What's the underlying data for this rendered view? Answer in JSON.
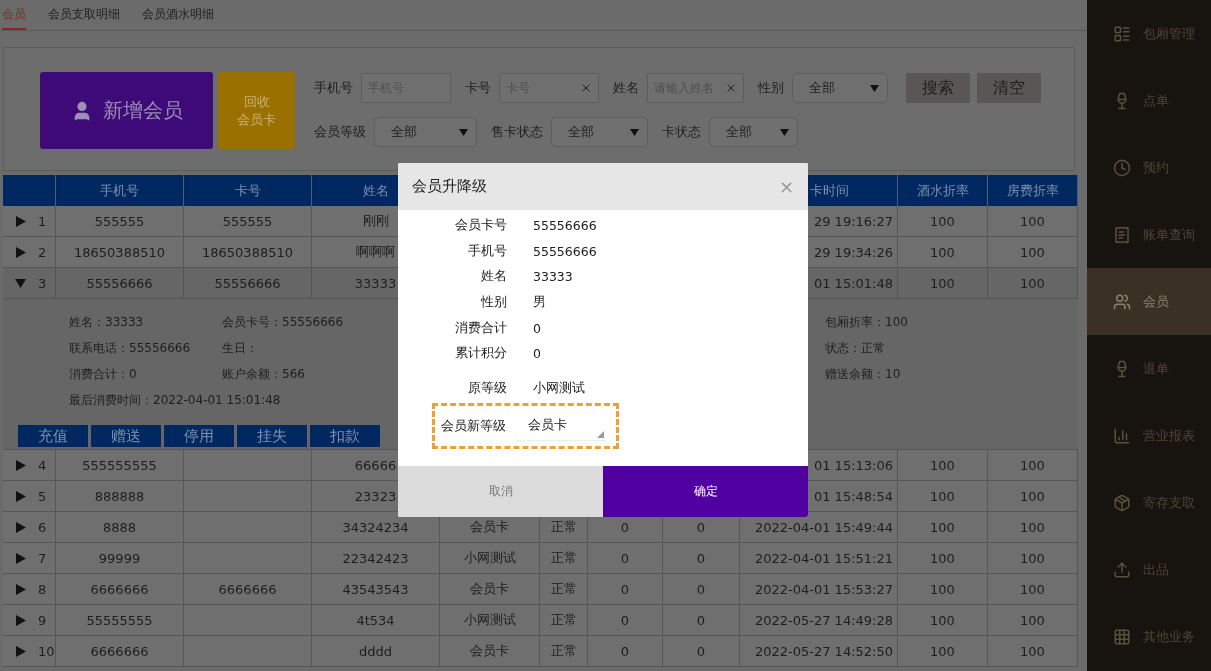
{
  "tabs": [
    {
      "label": "会员",
      "selected": true
    },
    {
      "label": "会员支取明细",
      "selected": false
    },
    {
      "label": "会员酒水明细",
      "selected": false
    }
  ],
  "filters": {
    "new_member": "新增会员",
    "recycle_card": [
      "回收",
      "会员卡"
    ],
    "rows": [
      [
        {
          "kind": "text",
          "label": "手机号",
          "placeholder": "手机号"
        },
        {
          "kind": "clearable",
          "label": "卡号",
          "placeholder": "卡号"
        },
        {
          "kind": "clearable",
          "label": "姓名",
          "placeholder": "请输入姓名"
        },
        {
          "kind": "select",
          "label": "性别",
          "value": "全部"
        }
      ],
      [
        {
          "kind": "select",
          "label": "会员等级",
          "value": "全部"
        },
        {
          "kind": "select",
          "label": "售卡状态",
          "value": "全部"
        },
        {
          "kind": "select",
          "label": "卡状态",
          "value": "全部"
        }
      ]
    ],
    "buttons": [
      "搜索",
      "清空"
    ]
  },
  "table": {
    "columns": [
      "",
      "手机号",
      "卡号",
      "姓名",
      "",
      "",
      "",
      "",
      "卡时间",
      "酒水折率",
      "房费折率"
    ],
    "rows": [
      {
        "expanded": false,
        "cells": [
          "1",
          "555555",
          "555555",
          "刚刚",
          "",
          "",
          "",
          "",
          "29 19:16:27",
          "100",
          "100"
        ]
      },
      {
        "expanded": false,
        "cells": [
          "2",
          "18650388510",
          "18650388510",
          "啊啊啊",
          "",
          "",
          "",
          "",
          "29 19:34:26",
          "100",
          "100"
        ]
      },
      {
        "expanded": true,
        "cells": [
          "3",
          "55556666",
          "55556666",
          "33333",
          "",
          "",
          "",
          "",
          "01 15:01:48",
          "100",
          "100"
        ],
        "details": [
          [
            "姓名：33333",
            "会员卡号：55556666",
            "包厢折率：100"
          ],
          [
            "联系电话：55556666",
            "生日：",
            "状态：正常"
          ],
          [
            "消费合计：0",
            "账户余额：566",
            "赠送余额：10"
          ],
          [
            "最后消费时间：2022-04-01 15:01:48"
          ]
        ],
        "actions": [
          "充值",
          "赠送",
          "停用",
          "挂失",
          "扣款"
        ]
      },
      {
        "expanded": false,
        "cells": [
          "4",
          "555555555",
          "",
          "66666",
          "",
          "",
          "",
          "",
          "01 15:13:06",
          "100",
          "100"
        ]
      },
      {
        "expanded": false,
        "cells": [
          "5",
          "888888",
          "",
          "23323",
          "",
          "",
          "",
          "",
          "01 15:48:54",
          "100",
          "100"
        ]
      },
      {
        "expanded": false,
        "cells": [
          "6",
          "8888",
          "",
          "34324234",
          "会员卡",
          "正常",
          "0",
          "0",
          "2022-04-01 15:49:44",
          "100",
          "100"
        ]
      },
      {
        "expanded": false,
        "cells": [
          "7",
          "99999",
          "",
          "22342423",
          "小网测试",
          "正常",
          "0",
          "0",
          "2022-04-01 15:51:21",
          "100",
          "100"
        ]
      },
      {
        "expanded": false,
        "cells": [
          "8",
          "6666666",
          "6666666",
          "43543543",
          "会员卡",
          "正常",
          "0",
          "0",
          "2022-04-01 15:53:27",
          "100",
          "100"
        ]
      },
      {
        "expanded": false,
        "cells": [
          "9",
          "55555555",
          "",
          "4t534",
          "小网测试",
          "正常",
          "0",
          "0",
          "2022-05-27 14:49:28",
          "100",
          "100"
        ]
      },
      {
        "expanded": false,
        "cells": [
          "10",
          "6666666",
          "",
          "dddd",
          "会员卡",
          "正常",
          "0",
          "0",
          "2022-05-27 14:52:50",
          "100",
          "100"
        ]
      }
    ]
  },
  "dialog": {
    "title": "会员升降级",
    "close": "×",
    "fields": [
      {
        "label": "会员卡号",
        "value": "55556666"
      },
      {
        "label": "手机号",
        "value": "55556666"
      },
      {
        "label": "姓名",
        "value": "33333"
      },
      {
        "label": "性别",
        "value": "男"
      },
      {
        "label": "消费合计",
        "value": "0"
      },
      {
        "label": "累计积分",
        "value": "0"
      }
    ],
    "original_level": {
      "label": "原等级",
      "value": "小网测试"
    },
    "new_level": {
      "label": "会员新等级",
      "value": "会员卡",
      "highlighted": true
    },
    "cancel": "取消",
    "confirm": "确定"
  },
  "sidebar": {
    "items": [
      {
        "label": "包厢管理",
        "selected": false
      },
      {
        "label": "点单",
        "selected": false
      },
      {
        "label": "预约",
        "selected": false
      },
      {
        "label": "账单查询",
        "selected": false
      },
      {
        "label": "会员",
        "selected": true
      },
      {
        "label": "退单",
        "selected": false
      },
      {
        "label": "营业报表",
        "selected": false
      },
      {
        "label": "寄存支取",
        "selected": false
      },
      {
        "label": "出品",
        "selected": false
      },
      {
        "label": "其他业务",
        "selected": false
      }
    ]
  }
}
